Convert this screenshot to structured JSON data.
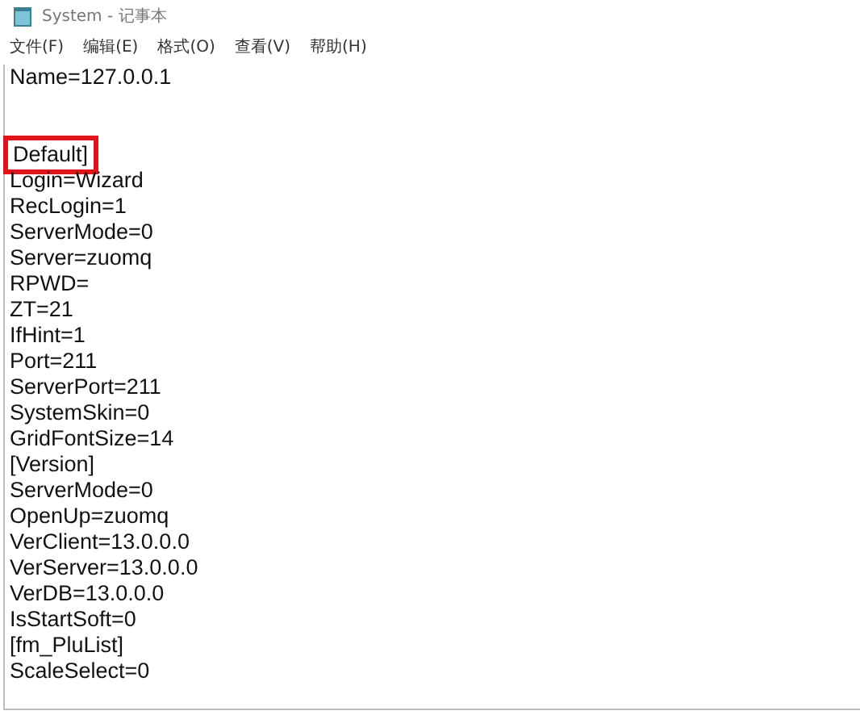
{
  "window": {
    "title": "System - 记事本"
  },
  "menu": [
    {
      "label": "文件(F)"
    },
    {
      "label": "编辑(E)"
    },
    {
      "label": "格式(O)"
    },
    {
      "label": "查看(V)"
    },
    {
      "label": "帮助(H)"
    }
  ],
  "lines": [
    {
      "kind": "text",
      "text": "Name=127.0.0.1",
      "highlighted": false
    },
    {
      "kind": "blank"
    },
    {
      "kind": "blank"
    },
    {
      "kind": "text",
      "text": "Default]",
      "highlighted": true
    },
    {
      "kind": "text",
      "text": "Login=Wizard",
      "highlighted": false
    },
    {
      "kind": "text",
      "text": "RecLogin=1",
      "highlighted": false
    },
    {
      "kind": "text",
      "text": "ServerMode=0",
      "highlighted": false
    },
    {
      "kind": "text",
      "text": "Server=zuomq",
      "highlighted": false
    },
    {
      "kind": "text",
      "text": "RPWD=",
      "highlighted": false
    },
    {
      "kind": "text",
      "text": "ZT=21",
      "highlighted": false
    },
    {
      "kind": "text",
      "text": "IfHint=1",
      "highlighted": false
    },
    {
      "kind": "text",
      "text": "Port=211",
      "highlighted": false
    },
    {
      "kind": "text",
      "text": "ServerPort=211",
      "highlighted": false
    },
    {
      "kind": "text",
      "text": "SystemSkin=0",
      "highlighted": false
    },
    {
      "kind": "text",
      "text": "GridFontSize=14",
      "highlighted": false
    },
    {
      "kind": "text",
      "text": "[Version]",
      "highlighted": false
    },
    {
      "kind": "text",
      "text": "ServerMode=0",
      "highlighted": false
    },
    {
      "kind": "text",
      "text": "OpenUp=zuomq",
      "highlighted": false
    },
    {
      "kind": "text",
      "text": "VerClient=13.0.0.0",
      "highlighted": false
    },
    {
      "kind": "text",
      "text": "VerServer=13.0.0.0",
      "highlighted": false
    },
    {
      "kind": "text",
      "text": "VerDB=13.0.0.0",
      "highlighted": false
    },
    {
      "kind": "text",
      "text": "IsStartSoft=0",
      "highlighted": false
    },
    {
      "kind": "text",
      "text": "[fm_PluList]",
      "highlighted": false
    },
    {
      "kind": "text",
      "text": "ScaleSelect=0",
      "highlighted": false
    }
  ]
}
